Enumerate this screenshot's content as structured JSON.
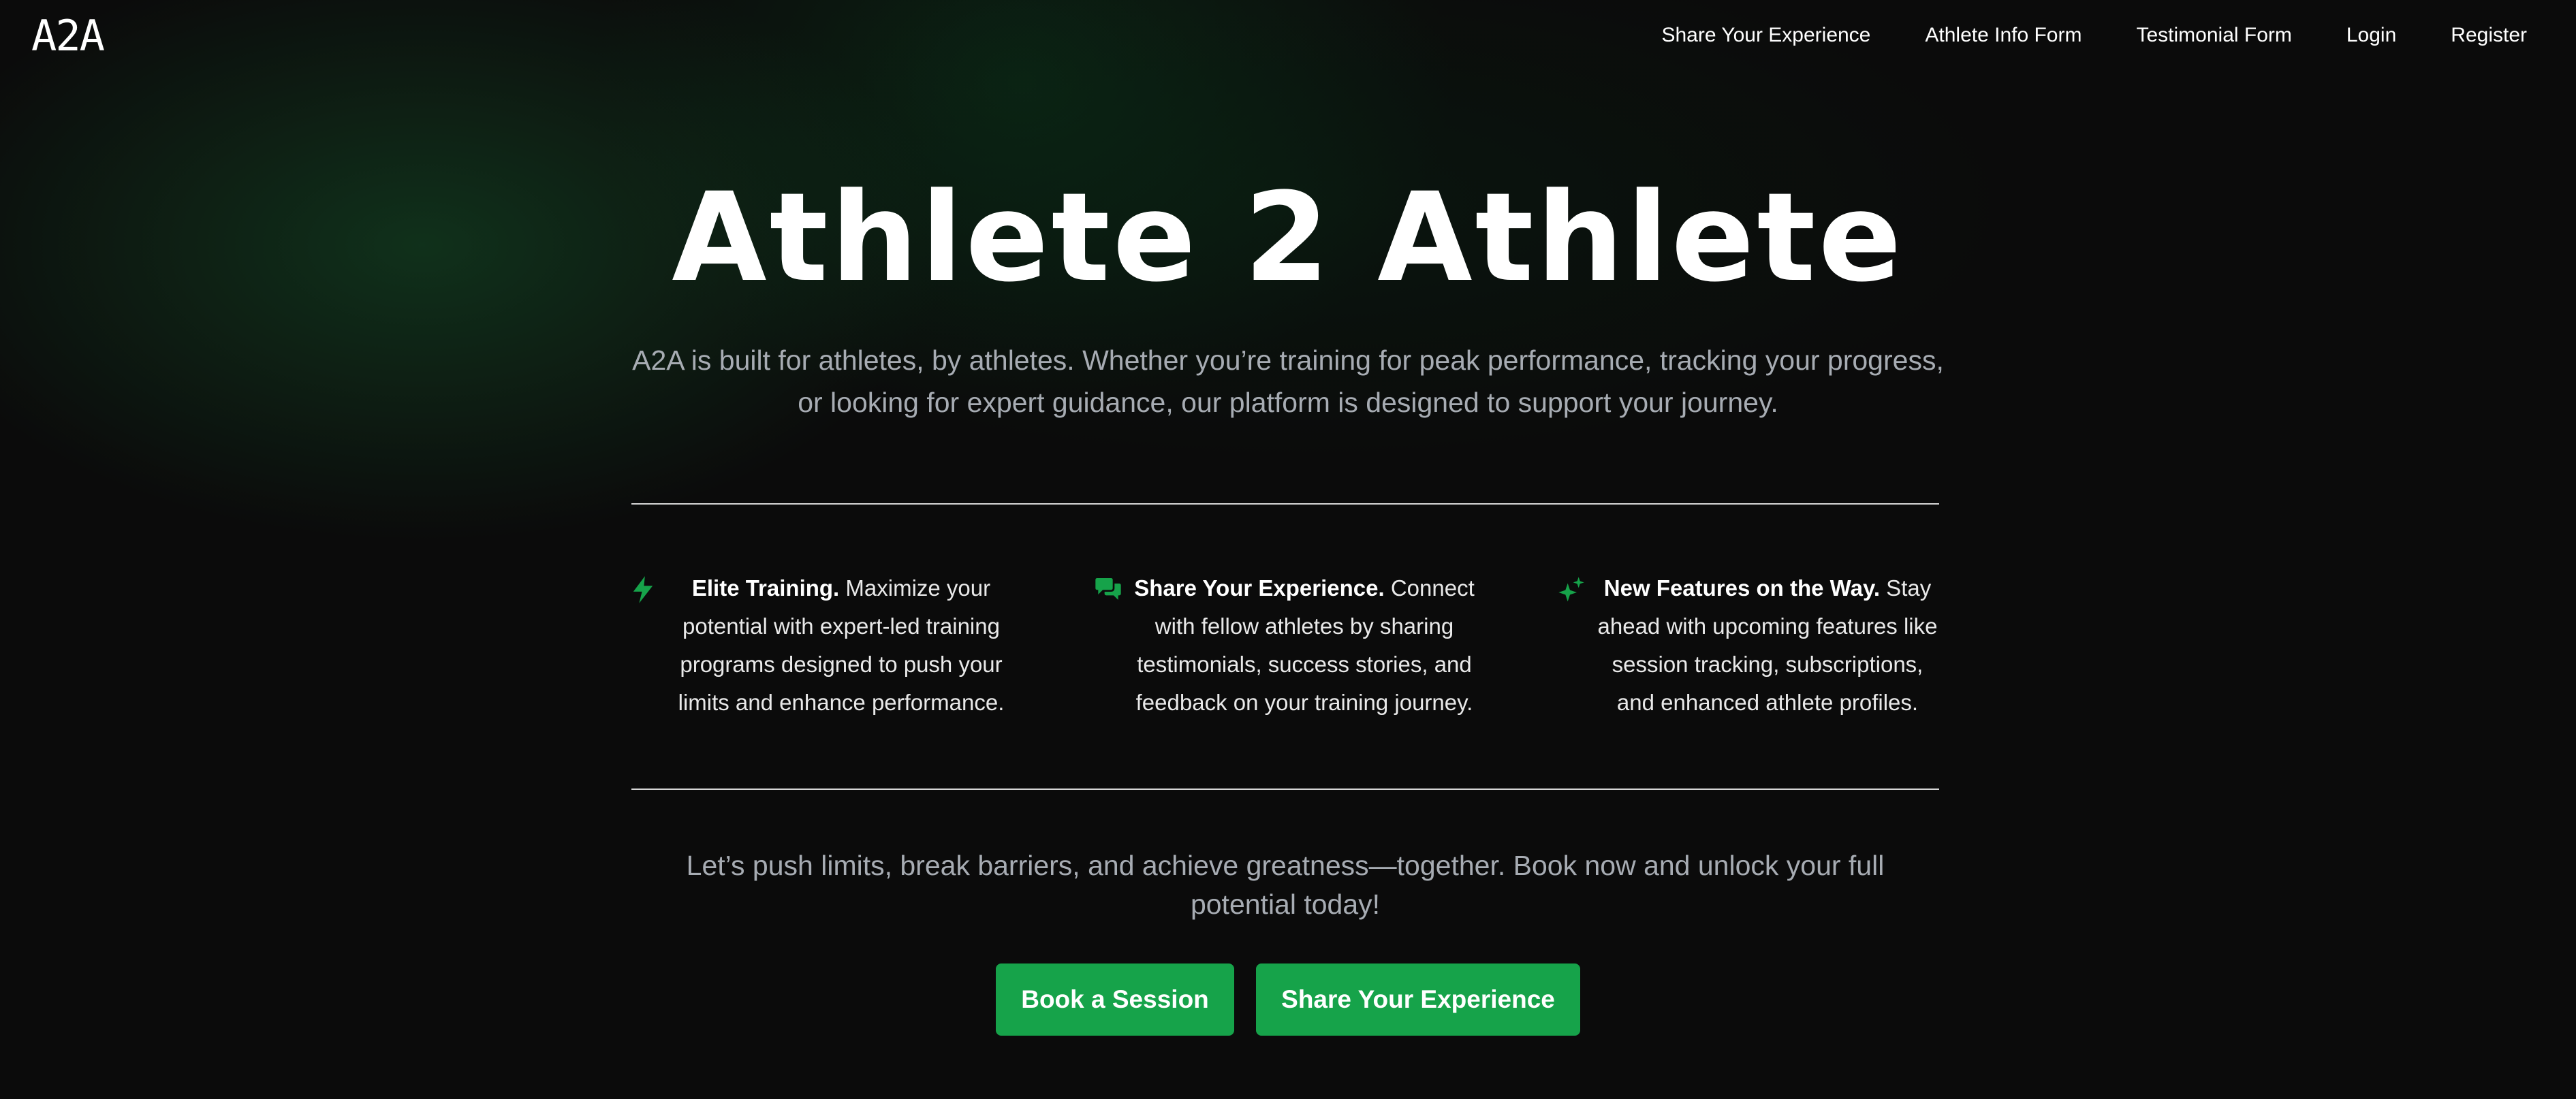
{
  "brand": {
    "logo_text": "A2A"
  },
  "nav": {
    "items": [
      {
        "label": "Share Your Experience"
      },
      {
        "label": "Athlete Info Form"
      },
      {
        "label": "Testimonial Form"
      },
      {
        "label": "Login"
      },
      {
        "label": "Register"
      }
    ]
  },
  "hero": {
    "title": "Athlete 2 Athlete",
    "subtitle": "A2A is built for athletes, by athletes. Whether you’re training for peak performance, tracking your progress, or looking for expert guidance, our platform is designed to support your journey."
  },
  "features": [
    {
      "icon": "lightning-bolt-icon",
      "title": "Elite Training.",
      "text": " Maximize your potential with expert-led training programs designed to push your limits and enhance performance."
    },
    {
      "icon": "chat-bubbles-icon",
      "title": "Share Your Experience.",
      "text": " Connect with fellow athletes by sharing testimonials, success stories, and feedback on your training journey."
    },
    {
      "icon": "sparkles-icon",
      "title": "New Features on the Way.",
      "text": " Stay ahead with upcoming features like session tracking, subscriptions, and enhanced athlete profiles."
    }
  ],
  "cta": {
    "text": "Let’s push limits, break barriers, and achieve greatness—together. Book now and unlock your full potential today!",
    "book_label": "Book a Session",
    "share_label": "Share Your Experience"
  },
  "colors": {
    "accent": "#16a34a",
    "background": "#0b0b0b",
    "muted_text": "#a7acb3"
  }
}
